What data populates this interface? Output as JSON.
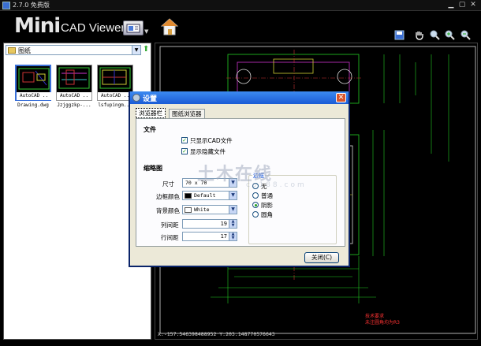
{
  "window": {
    "title": "2.7.0 免费版"
  },
  "logo": {
    "mini": "Mini",
    "cad": "CAD Viewer"
  },
  "left_panel": {
    "folder": "图纸",
    "files": [
      {
        "caption": "AutoCAD ..",
        "name": "Drawing.dwg",
        "selected": true
      },
      {
        "caption": "AutoCAD ..",
        "name": "Jzjggzkp-...",
        "selected": false
      },
      {
        "caption": "AutoCAD ..",
        "name": "lsfupingm...",
        "selected": false
      }
    ]
  },
  "status": {
    "coords": "X:-157.546398488952  Y:203.148770576643"
  },
  "drawing_note": {
    "line1": "技术要求",
    "line2": "未注圆角均为R3"
  },
  "watermark": {
    "main": "土木在线",
    "sub": "co188.com"
  },
  "dialog": {
    "title": "设置",
    "tabs": [
      "浏览器栏",
      "图纸浏览器"
    ],
    "file_section": "文件",
    "show_cad_only": "只显示CAD文件",
    "show_hidden": "显示隐藏文件",
    "thumb_section": "缩略图",
    "size_label": "尺寸",
    "size_value": "70 x 70",
    "border_color_label": "边框颜色",
    "border_color_value": "Default",
    "bg_color_label": "背景颜色",
    "bg_color_value": "White",
    "col_spacing_label": "列间距",
    "col_spacing_value": "19",
    "row_spacing_label": "行间距",
    "row_spacing_value": "17",
    "border_group": "边框",
    "border_options": [
      "无",
      "普通",
      "阴影",
      "圆角"
    ],
    "border_selected": "阴影",
    "close_label": "关闭(C)",
    "border_swatch": "#000000",
    "bg_swatch": "#ffffff"
  }
}
